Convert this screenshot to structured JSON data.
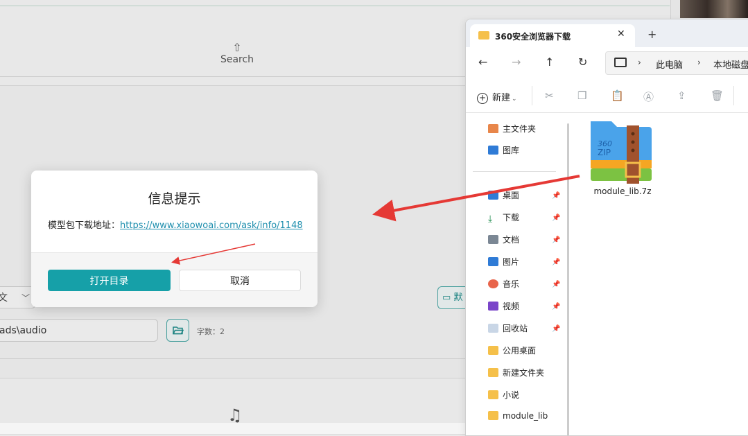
{
  "background_app": {
    "search_label": "Search",
    "search_icon": "upload-icon",
    "lang_select_value": "文",
    "path_input_value": "ads\\audio",
    "char_count_label": "字数：2",
    "right_button_label": "默",
    "music_icon": "music-note-icon"
  },
  "dialog": {
    "title": "信息提示",
    "message_label": "模型包下载地址：",
    "message_link": "https://www.xiaowoai.com/ask/info/1148",
    "open_dir_label": "打开目录",
    "cancel_label": "取消"
  },
  "explorer": {
    "tab_title": "360安全浏览器下载",
    "tab_close": "✕",
    "tab_new": "+",
    "breadcrumb": [
      "此电脑",
      "本地磁盘"
    ],
    "toolbar_new_label": "新建",
    "sidebar": {
      "top_items": [
        {
          "label": "主文件夹",
          "icon": "home-icon"
        },
        {
          "label": "图库",
          "icon": "gallery-icon"
        }
      ],
      "items": [
        {
          "label": "桌面",
          "icon": "desktop-icon",
          "pinned": true
        },
        {
          "label": "下载",
          "icon": "download-icon",
          "pinned": true
        },
        {
          "label": "文档",
          "icon": "document-icon",
          "pinned": true
        },
        {
          "label": "图片",
          "icon": "pictures-icon",
          "pinned": true
        },
        {
          "label": "音乐",
          "icon": "music-icon",
          "pinned": true
        },
        {
          "label": "视频",
          "icon": "video-icon",
          "pinned": true
        },
        {
          "label": "回收站",
          "icon": "recycle-bin-icon",
          "pinned": true
        },
        {
          "label": "公用桌面",
          "icon": "folder-icon",
          "pinned": false
        },
        {
          "label": "新建文件夹",
          "icon": "folder-icon",
          "pinned": false
        },
        {
          "label": "小说",
          "icon": "folder-icon",
          "pinned": false
        },
        {
          "label": "module_lib",
          "icon": "folder-icon",
          "pinned": false
        }
      ]
    },
    "files": [
      {
        "name": "module_lib.7z",
        "icon": "360zip-archive-icon",
        "icon_text": "360 ZIP"
      }
    ]
  },
  "colors": {
    "accent": "#16a0a8",
    "link": "#1f8fae",
    "arrow": "#e53935",
    "folder": "#f5c04a"
  }
}
